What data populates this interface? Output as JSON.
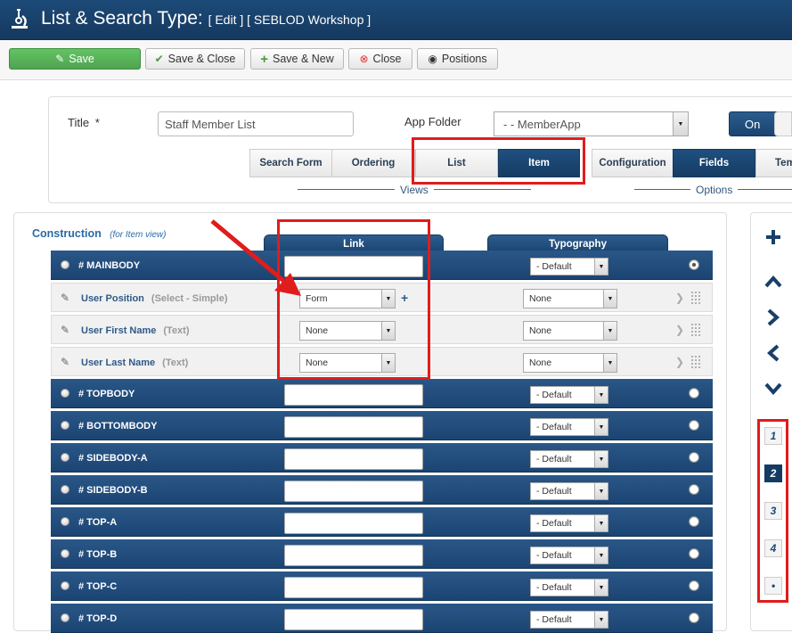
{
  "header": {
    "title": "List & Search Type:",
    "subtitle": "[ Edit ] [ SEBLOD Workshop ]"
  },
  "toolbar": {
    "save": "Save",
    "save_close": "Save & Close",
    "save_new": "Save & New",
    "close": "Close",
    "positions": "Positions"
  },
  "form": {
    "title_label": "Title",
    "required_mark": "*",
    "title_value": "Staff Member List",
    "app_folder_label": "App Folder",
    "app_folder_value": "- - MemberApp",
    "toggle_on": "On"
  },
  "view_tabs": [
    "Search Form",
    "Ordering",
    "List",
    "Item"
  ],
  "option_tabs": [
    "Configuration",
    "Fields",
    "Tem"
  ],
  "groups": {
    "views": "Views",
    "options": "Options"
  },
  "construction": {
    "title": "Construction",
    "subtitle": "(for Item view)"
  },
  "columns": {
    "link": "Link",
    "typography": "Typography"
  },
  "rows": [
    {
      "kind": "position",
      "name": "# MAINBODY",
      "typo": "- Default",
      "checked": true
    },
    {
      "kind": "field",
      "name": "User Position",
      "type": "(Select - Simple)",
      "link": "Form",
      "typo": "None"
    },
    {
      "kind": "field",
      "name": "User First Name",
      "type": "(Text)",
      "link": "None",
      "typo": "None"
    },
    {
      "kind": "field",
      "name": "User Last Name",
      "type": "(Text)",
      "link": "None",
      "typo": "None"
    },
    {
      "kind": "position",
      "name": "# TOPBODY",
      "typo": "- Default"
    },
    {
      "kind": "position",
      "name": "# BOTTOMBODY",
      "typo": "- Default"
    },
    {
      "kind": "position",
      "name": "# SIDEBODY-A",
      "typo": "- Default"
    },
    {
      "kind": "position",
      "name": "# SIDEBODY-B",
      "typo": "- Default"
    },
    {
      "kind": "position",
      "name": "# TOP-A",
      "typo": "- Default"
    },
    {
      "kind": "position",
      "name": "# TOP-B",
      "typo": "- Default"
    },
    {
      "kind": "position",
      "name": "# TOP-C",
      "typo": "- Default"
    },
    {
      "kind": "position",
      "name": "# TOP-D",
      "typo": "- Default"
    }
  ],
  "side_numbers": [
    "1",
    "2",
    "3",
    "4",
    "•"
  ],
  "side_active": "2",
  "colors": {
    "header": "#1c4a78",
    "accent": "#1f4f80",
    "annotation": "#e01c1c",
    "save": "#5bb75b"
  },
  "icons": [
    "logo-microscope-icon",
    "save-icon",
    "check-icon",
    "plus-icon",
    "close-circle-icon",
    "eye-icon",
    "pencil-icon",
    "chevron-up-icon",
    "chevron-right-icon",
    "chevron-left-icon",
    "chevron-down-icon",
    "grip-icon"
  ]
}
